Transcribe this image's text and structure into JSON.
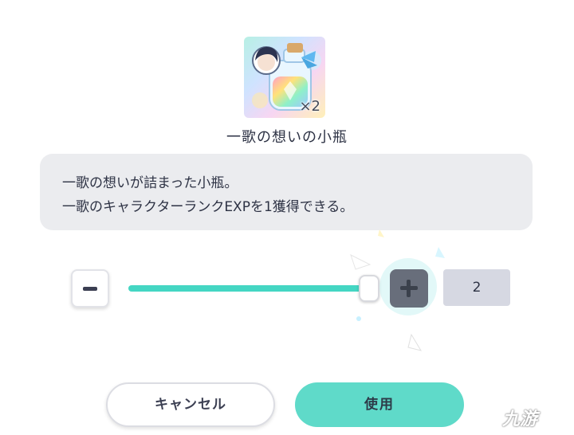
{
  "item": {
    "name": "一歌の想いの小瓶",
    "quantity_badge": "×2",
    "icon": "bottle-icon"
  },
  "description": {
    "line1": "一歌の想いが詰まった小瓶。",
    "line2": "一歌のキャラクターランクEXPを1獲得できる。"
  },
  "quantity": {
    "value": "2",
    "slider_fraction": 1.0,
    "minus_icon": "minus-icon",
    "plus_icon": "plus-icon"
  },
  "buttons": {
    "cancel_label": "キャンセル",
    "use_label": "使用"
  },
  "watermark": {
    "text": "九游"
  },
  "colors": {
    "accent": "#44d6c3",
    "use_button": "#5fdac9",
    "description_bg": "#ebecef"
  }
}
